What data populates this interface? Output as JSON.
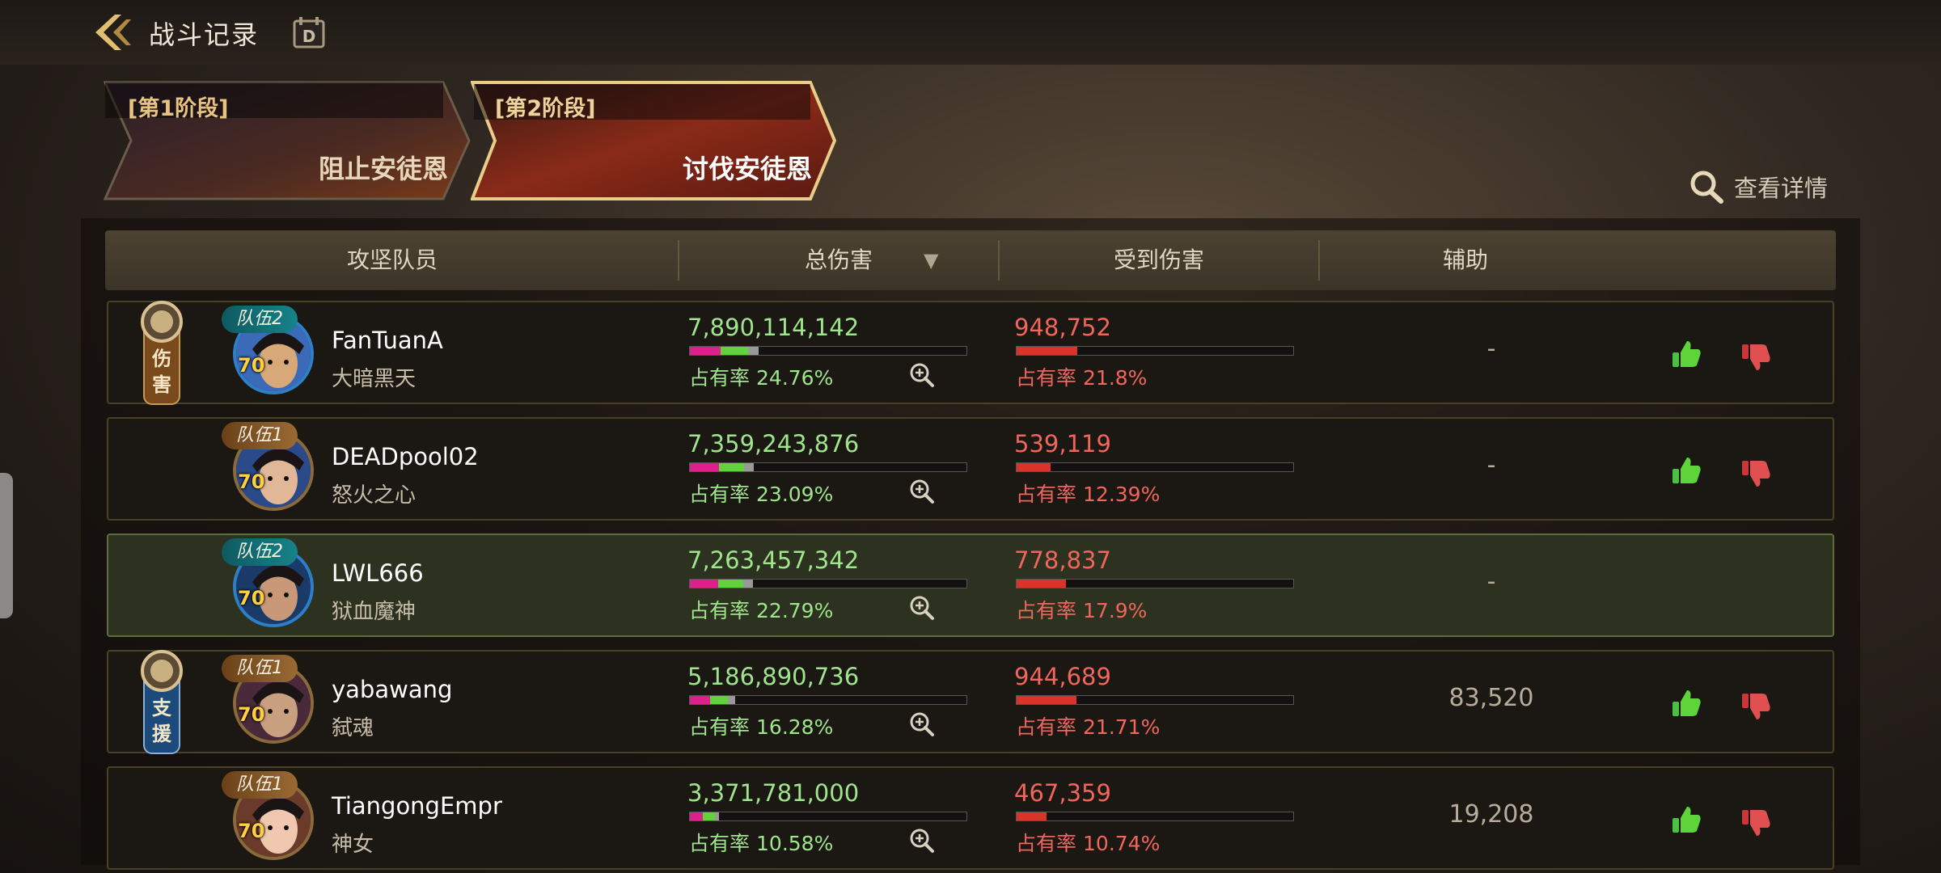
{
  "header": {
    "title": "战斗记录",
    "back_icon": "back-arrow-icon",
    "calendar_icon": "calendar-d-icon"
  },
  "stages": [
    {
      "label": "[第1阶段]",
      "name": "阻止安徒恩",
      "active": false
    },
    {
      "label": "[第2阶段]",
      "name": "讨伐安徒恩",
      "active": true
    }
  ],
  "details_label": "查看详情",
  "columns": {
    "member": "攻坚队员",
    "total_damage": "总伤害",
    "damage_taken": "受到伤害",
    "assist": "辅助"
  },
  "rate_label": "占有率",
  "colors": {
    "damage": "#9fe58c",
    "taken": "#f0665c",
    "gold": "#e7c382",
    "team2": "#17838a",
    "team1": "#9a6a34"
  },
  "players": [
    {
      "team": "队伍2",
      "level": "70",
      "name": "FanTuanA",
      "hero": "大暗黑天",
      "damage": "7,890,114,142",
      "damage_rate": "24.76%",
      "damage_share": 24.76,
      "taken": "948,752",
      "taken_rate": "21.8%",
      "taken_share": 21.8,
      "assist": "-",
      "badge": "伤害",
      "highlight": false,
      "feedback": true
    },
    {
      "team": "队伍1",
      "level": "70",
      "name": "DEADpool02",
      "hero": "怒火之心",
      "damage": "7,359,243,876",
      "damage_rate": "23.09%",
      "damage_share": 23.09,
      "taken": "539,119",
      "taken_rate": "12.39%",
      "taken_share": 12.39,
      "assist": "-",
      "badge": "",
      "highlight": false,
      "feedback": true
    },
    {
      "team": "队伍2",
      "level": "70",
      "name": "LWL666",
      "hero": "狱血魔神",
      "damage": "7,263,457,342",
      "damage_rate": "22.79%",
      "damage_share": 22.79,
      "taken": "778,837",
      "taken_rate": "17.9%",
      "taken_share": 17.9,
      "assist": "-",
      "badge": "",
      "highlight": true,
      "feedback": false
    },
    {
      "team": "队伍1",
      "level": "70",
      "name": "yabawang",
      "hero": "弑魂",
      "damage": "5,186,890,736",
      "damage_rate": "16.28%",
      "damage_share": 16.28,
      "taken": "944,689",
      "taken_rate": "21.71%",
      "taken_share": 21.71,
      "assist": "83,520",
      "badge": "支援",
      "highlight": false,
      "feedback": true
    },
    {
      "team": "队伍1",
      "level": "70",
      "name": "TiangongEmpr",
      "hero": "神女",
      "damage": "3,371,781,000",
      "damage_rate": "10.58%",
      "damage_share": 10.58,
      "taken": "467,359",
      "taken_rate": "10.74%",
      "taken_share": 10.74,
      "assist": "19,208",
      "badge": "",
      "highlight": false,
      "feedback": true
    }
  ]
}
